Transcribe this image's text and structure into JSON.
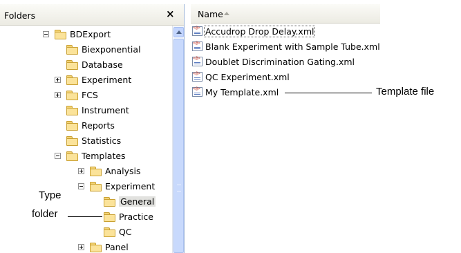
{
  "folders_pane": {
    "title": "Folders",
    "close_glyph": "×",
    "tree": [
      {
        "label": "BDExport",
        "expander": "minus"
      },
      {
        "label": "Biexponential",
        "expander": "none"
      },
      {
        "label": "Database",
        "expander": "none"
      },
      {
        "label": "Experiment",
        "expander": "plus"
      },
      {
        "label": "FCS",
        "expander": "plus"
      },
      {
        "label": "Instrument",
        "expander": "none"
      },
      {
        "label": "Reports",
        "expander": "none"
      },
      {
        "label": "Statistics",
        "expander": "none"
      },
      {
        "label": "Templates",
        "expander": "minus"
      },
      {
        "label": "Analysis",
        "expander": "plus"
      },
      {
        "label": "Experiment",
        "expander": "minus"
      },
      {
        "label": "General",
        "expander": "none",
        "selected": true
      },
      {
        "label": "Practice",
        "expander": "none"
      },
      {
        "label": "QC",
        "expander": "none"
      },
      {
        "label": "Panel",
        "expander": "plus"
      }
    ]
  },
  "files_pane": {
    "column_header": "Name",
    "files": [
      {
        "label": "Accudrop Drop Delay.xml",
        "focused": true
      },
      {
        "label": "Blank Experiment with Sample Tube.xml"
      },
      {
        "label": "Doublet Discrimination Gating.xml"
      },
      {
        "label": "QC Experiment.xml"
      },
      {
        "label": "My Template.xml"
      }
    ]
  },
  "callouts": {
    "template_file": "Template file",
    "type_folder_line1": "Type",
    "type_folder_line2": "folder"
  },
  "colors": {
    "folder_fill": "#fbe39a",
    "scrollbar": "#c8d9fc",
    "header_bg": "#ecebe3"
  }
}
